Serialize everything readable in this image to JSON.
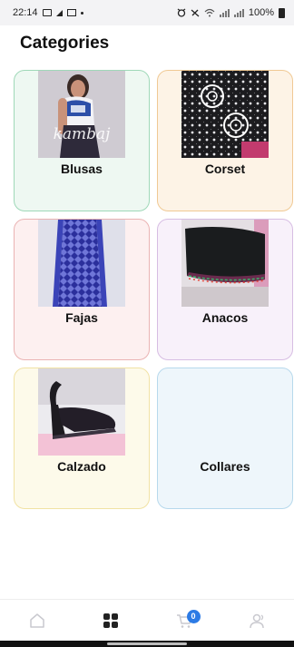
{
  "status_bar": {
    "time": "22:14",
    "battery": "100%"
  },
  "header": {
    "title": "Categories"
  },
  "categories": [
    {
      "label": "Blusas",
      "image_caption": "kambaj"
    },
    {
      "label": "Corset"
    },
    {
      "label": "Fajas"
    },
    {
      "label": "Anacos"
    },
    {
      "label": "Calzado"
    },
    {
      "label": "Collares"
    }
  ],
  "bottom_nav": {
    "cart_badge": "0",
    "items": [
      "home-icon",
      "grid-icon",
      "cart-icon",
      "profile-icon"
    ]
  },
  "colors": {
    "accent": "#2c7be5",
    "active_icon": "#222222",
    "inactive_icon": "#c9c9cf"
  }
}
